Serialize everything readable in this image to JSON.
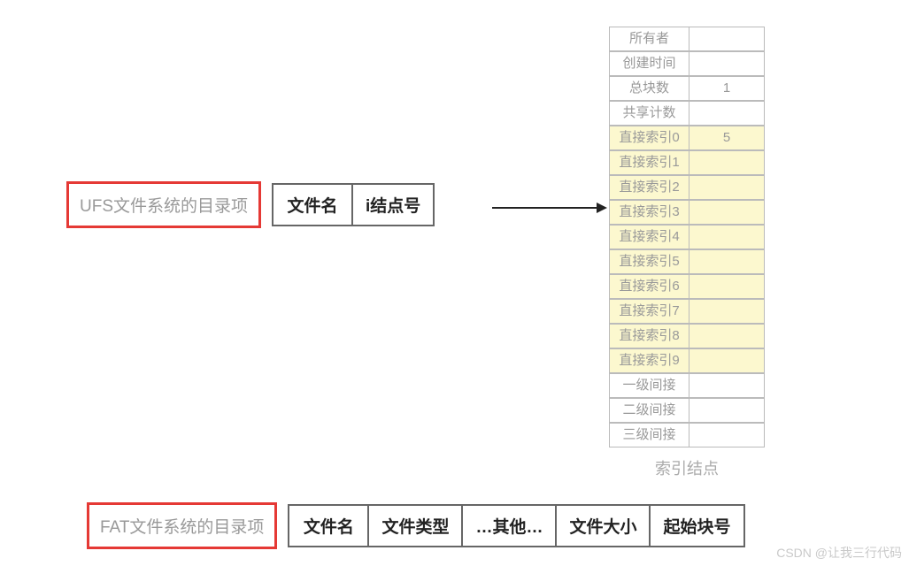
{
  "ufs": {
    "title": "UFS文件系统的目录项",
    "cols": [
      "文件名",
      "i结点号"
    ]
  },
  "inode": {
    "caption": "索引结点",
    "rows": [
      {
        "label": "所有者",
        "value": "",
        "yellow": false
      },
      {
        "label": "创建时间",
        "value": "",
        "yellow": false
      },
      {
        "label": "总块数",
        "value": "1",
        "yellow": false
      },
      {
        "label": "共享计数",
        "value": "",
        "yellow": false
      },
      {
        "label": "直接索引0",
        "value": "5",
        "yellow": true
      },
      {
        "label": "直接索引1",
        "value": "",
        "yellow": true
      },
      {
        "label": "直接索引2",
        "value": "",
        "yellow": true
      },
      {
        "label": "直接索引3",
        "value": "",
        "yellow": true
      },
      {
        "label": "直接索引4",
        "value": "",
        "yellow": true
      },
      {
        "label": "直接索引5",
        "value": "",
        "yellow": true
      },
      {
        "label": "直接索引6",
        "value": "",
        "yellow": true
      },
      {
        "label": "直接索引7",
        "value": "",
        "yellow": true
      },
      {
        "label": "直接索引8",
        "value": "",
        "yellow": true
      },
      {
        "label": "直接索引9",
        "value": "",
        "yellow": true
      },
      {
        "label": "一级间接",
        "value": "",
        "yellow": false
      },
      {
        "label": "二级间接",
        "value": "",
        "yellow": false
      },
      {
        "label": "三级间接",
        "value": "",
        "yellow": false
      }
    ]
  },
  "fat": {
    "title": "FAT文件系统的目录项",
    "cols": [
      "文件名",
      "文件类型",
      "…其他…",
      "文件大小",
      "起始块号"
    ]
  },
  "watermark": "CSDN @让我三行代码"
}
